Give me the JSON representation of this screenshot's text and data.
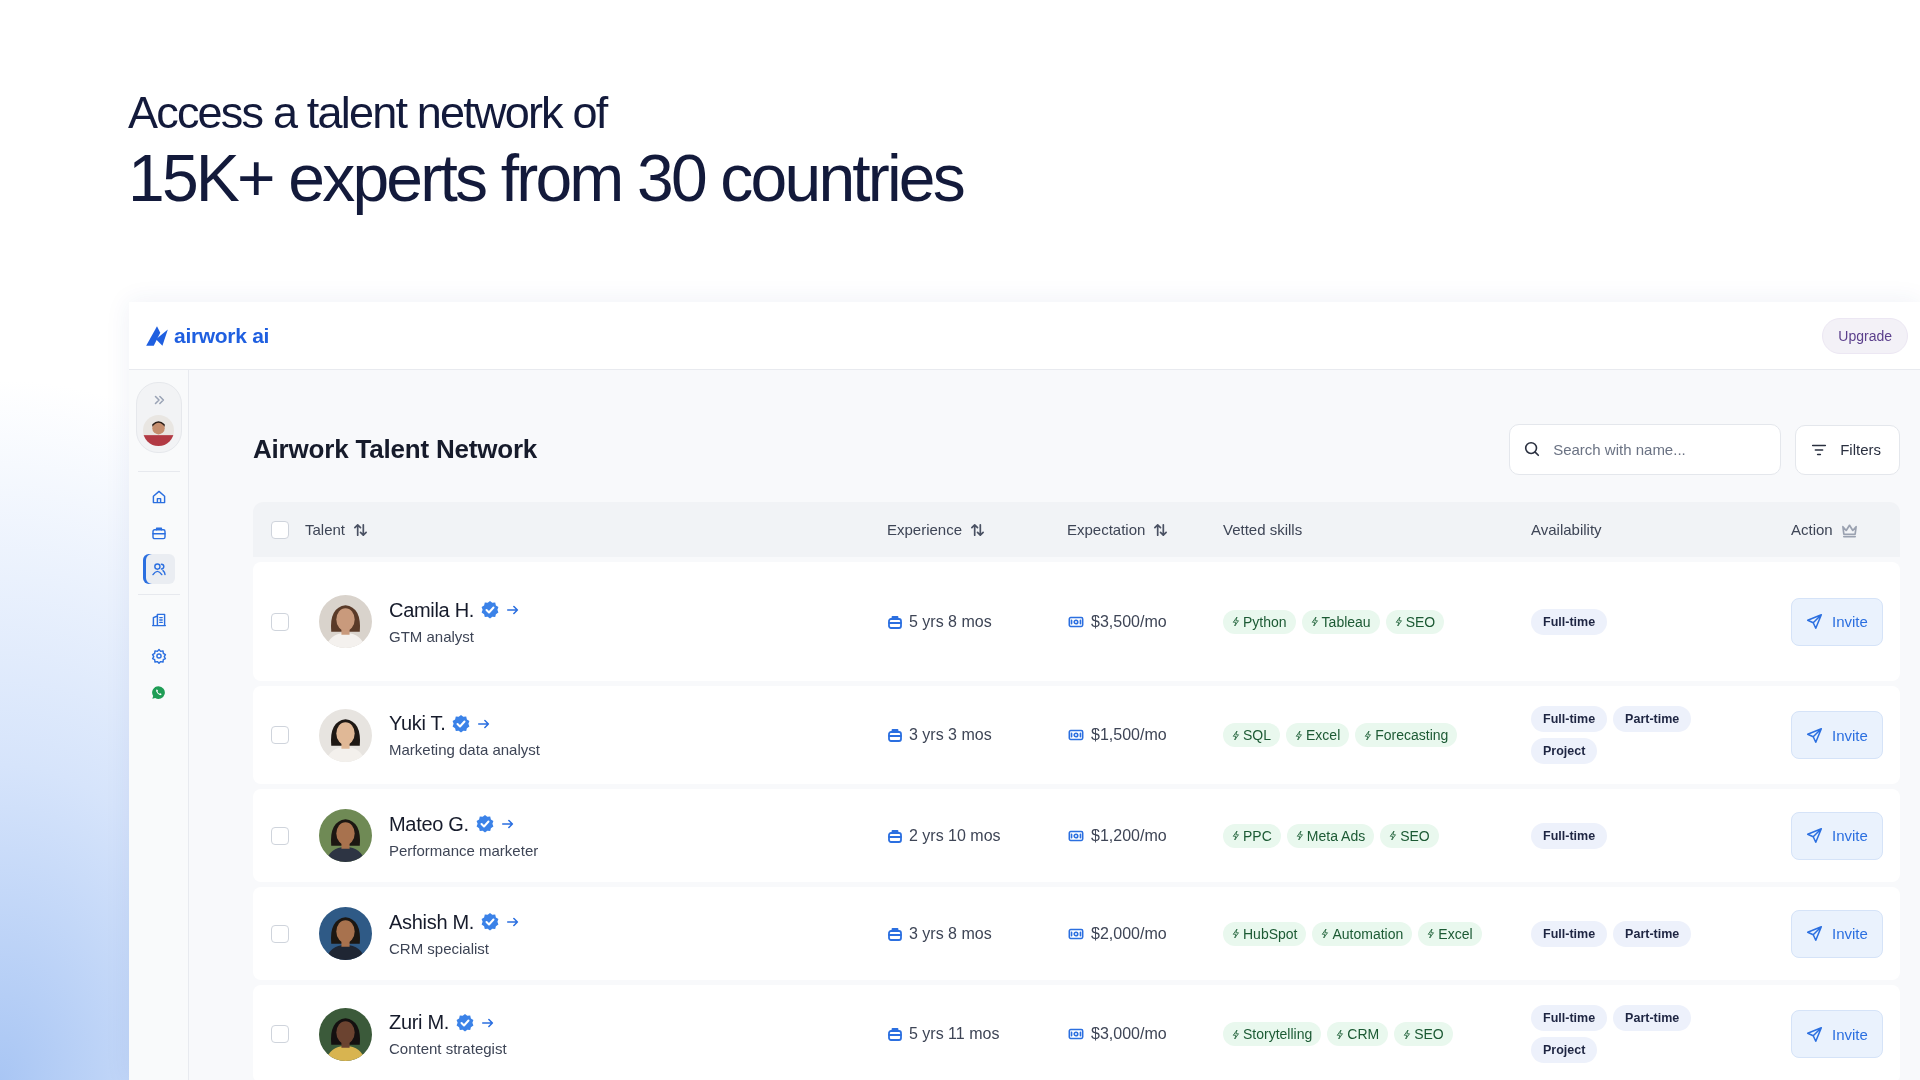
{
  "headline": {
    "line_1": "Access a talent network of",
    "line_2": "15K+ experts from 30 countries"
  },
  "app": {
    "logo": "airwork ai",
    "upgrade_button": "Upgrade",
    "sidebar": {
      "nav_groups": [
        [
          {
            "selected": false
          },
          {
            "selected": false
          },
          {
            "selected": true
          }
        ],
        [
          {
            "selected": false
          },
          {
            "selected": false
          },
          {
            "selected": false
          }
        ]
      ]
    },
    "page_title": "Airwork Talent Network",
    "search": {
      "placeholder": "Search with name..."
    },
    "filters_button": "Filters",
    "table": {
      "select_all": {
        "checked": false
      },
      "columns": [
        {
          "label": "Talent",
          "kind": "sortable"
        },
        {
          "label": "Experience",
          "kind": "sortable"
        },
        {
          "label": "Expectation",
          "kind": "sortable"
        },
        {
          "label": "Vetted skills",
          "kind": "plain"
        },
        {
          "label": "Availability",
          "kind": "plain"
        },
        {
          "label": "Action",
          "kind": "premium"
        }
      ],
      "rows": [
        {
          "checked": false,
          "name": "Camila H.",
          "verified": true,
          "role": "GTM analyst",
          "experience": "5 yrs 8 mos",
          "expectation": "$3,500/mo",
          "skills": [
            "Python",
            "Tableau",
            "SEO"
          ],
          "availability": [
            "Full-time"
          ],
          "action": "Invite"
        },
        {
          "checked": false,
          "name": "Yuki T.",
          "verified": true,
          "role": "Marketing data analyst",
          "experience": "3 yrs 3 mos",
          "expectation": "$1,500/mo",
          "skills": [
            "SQL",
            "Excel",
            "Forecasting"
          ],
          "availability": [
            "Full-time",
            "Part-time",
            "Project"
          ],
          "action": "Invite"
        },
        {
          "checked": false,
          "name": "Mateo G.",
          "verified": true,
          "role": "Performance marketer",
          "experience": "2 yrs 10 mos",
          "expectation": "$1,200/mo",
          "skills": [
            "PPC",
            "Meta Ads",
            "SEO"
          ],
          "availability": [
            "Full-time"
          ],
          "action": "Invite"
        },
        {
          "checked": false,
          "name": "Ashish M.",
          "verified": true,
          "role": "CRM specialist",
          "experience": "3 yrs 8 mos",
          "expectation": "$2,000/mo",
          "skills": [
            "HubSpot",
            "Automation",
            "Excel"
          ],
          "availability": [
            "Full-time",
            "Part-time"
          ],
          "action": "Invite"
        },
        {
          "checked": false,
          "name": "Zuri M.",
          "verified": true,
          "role": "Content strategist",
          "experience": "5 yrs 11 mos",
          "expectation": "$3,000/mo",
          "skills": [
            "Storytelling",
            "CRM",
            "SEO"
          ],
          "availability": [
            "Full-time",
            "Part-time",
            "Project"
          ],
          "action": "Invite"
        }
      ]
    }
  }
}
